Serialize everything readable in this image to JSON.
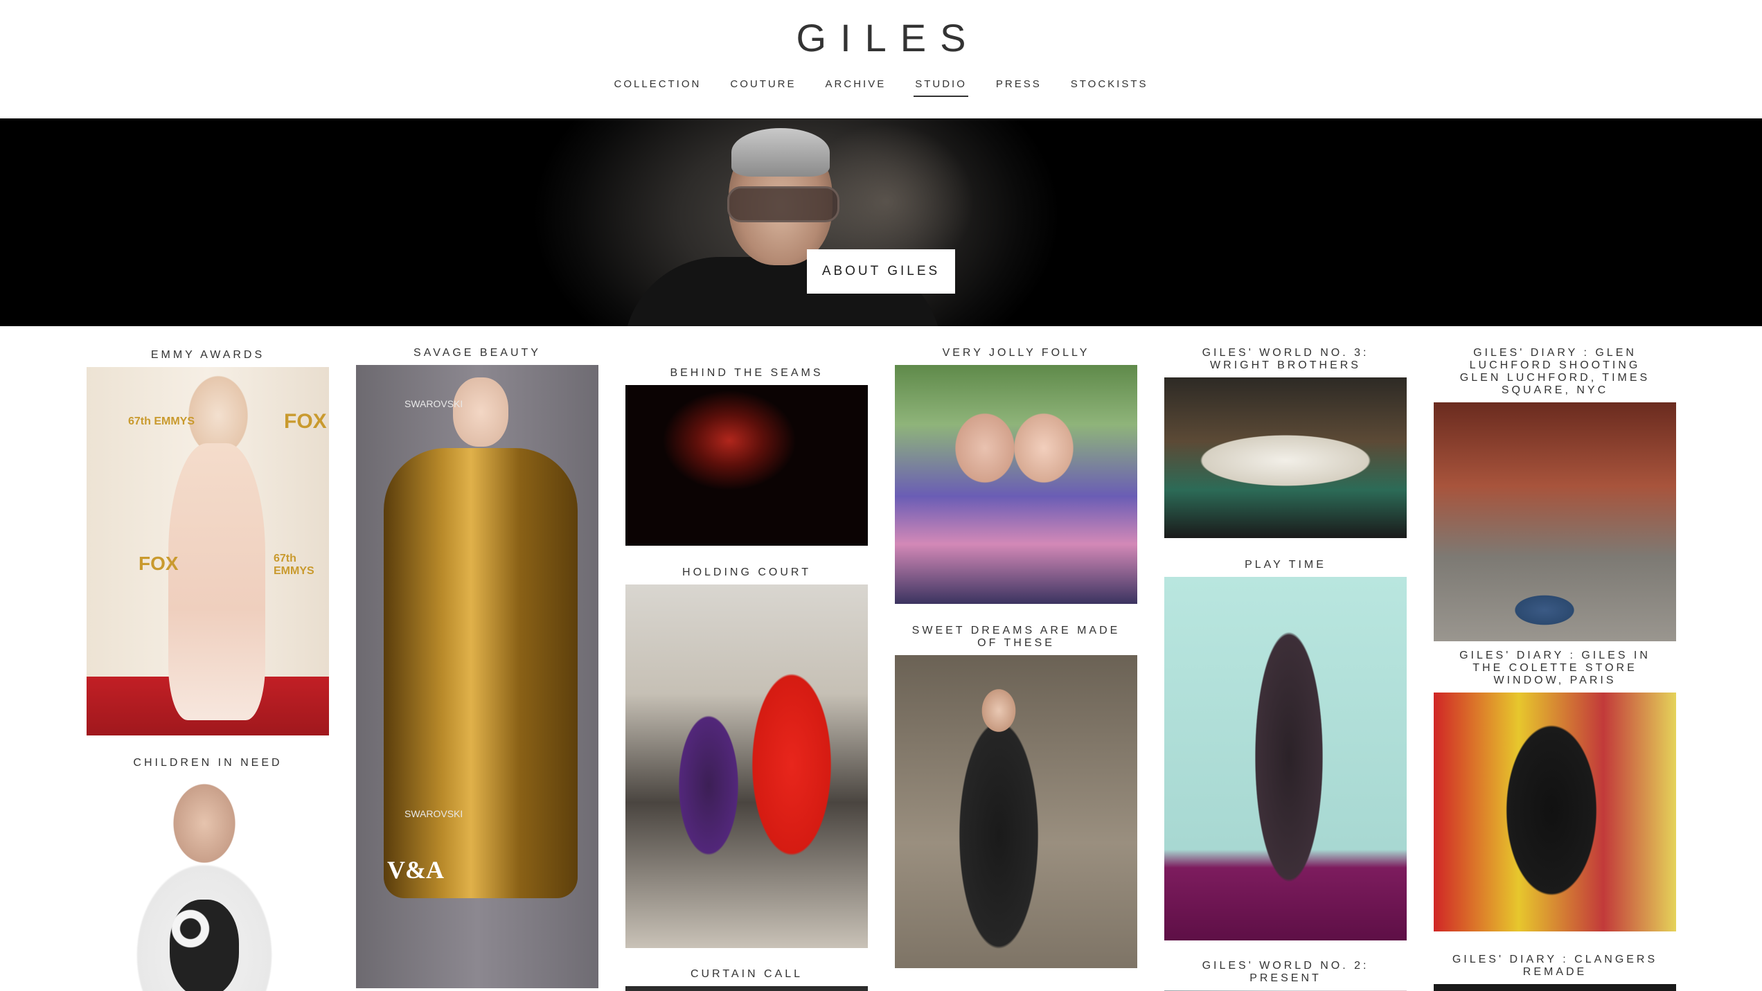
{
  "site": {
    "logo": "GILES"
  },
  "nav": {
    "items": [
      {
        "label": "COLLECTION"
      },
      {
        "label": "COUTURE"
      },
      {
        "label": "ARCHIVE"
      },
      {
        "label": "STUDIO",
        "active": true
      },
      {
        "label": "PRESS"
      },
      {
        "label": "STOCKISTS"
      }
    ]
  },
  "hero": {
    "button_label": "ABOUT GILES"
  },
  "cards": [
    {
      "title": "EMMY AWARDS"
    },
    {
      "title": "CHILDREN IN NEED"
    },
    {
      "title": "SAVAGE BEAUTY"
    },
    {
      "title": "BEHIND THE SEAMS"
    },
    {
      "title": "HOLDING COURT"
    },
    {
      "title": "CURTAIN CALL"
    },
    {
      "title": "VERY JOLLY FOLLY"
    },
    {
      "title": "SWEET DREAMS ARE MADE OF THESE"
    },
    {
      "title": "GILES' WORLD NO. 3: WRIGHT BROTHERS"
    },
    {
      "title": "PLAY TIME"
    },
    {
      "title": "GILES' WORLD NO. 2: PRESENT"
    },
    {
      "title": "GILES' DIARY : GLEN LUCHFORD SHOOTING GLEN LUCHFORD, TIMES SQUARE, NYC"
    },
    {
      "title": "GILES' DIARY : GILES IN THE COLETTE STORE WINDOW, PARIS"
    },
    {
      "title": "GILES' DIARY : CLANGERS REMADE"
    }
  ],
  "image_text": {
    "emmy_brand": "FOX",
    "emmy_mark": "67th EMMYS",
    "savage_sponsor": "SWAROVSKI",
    "savage_museum": "V&A"
  },
  "colors": {
    "text": "#2a2a2a",
    "hero_bg": "#000000",
    "button_bg": "#ffffff"
  }
}
